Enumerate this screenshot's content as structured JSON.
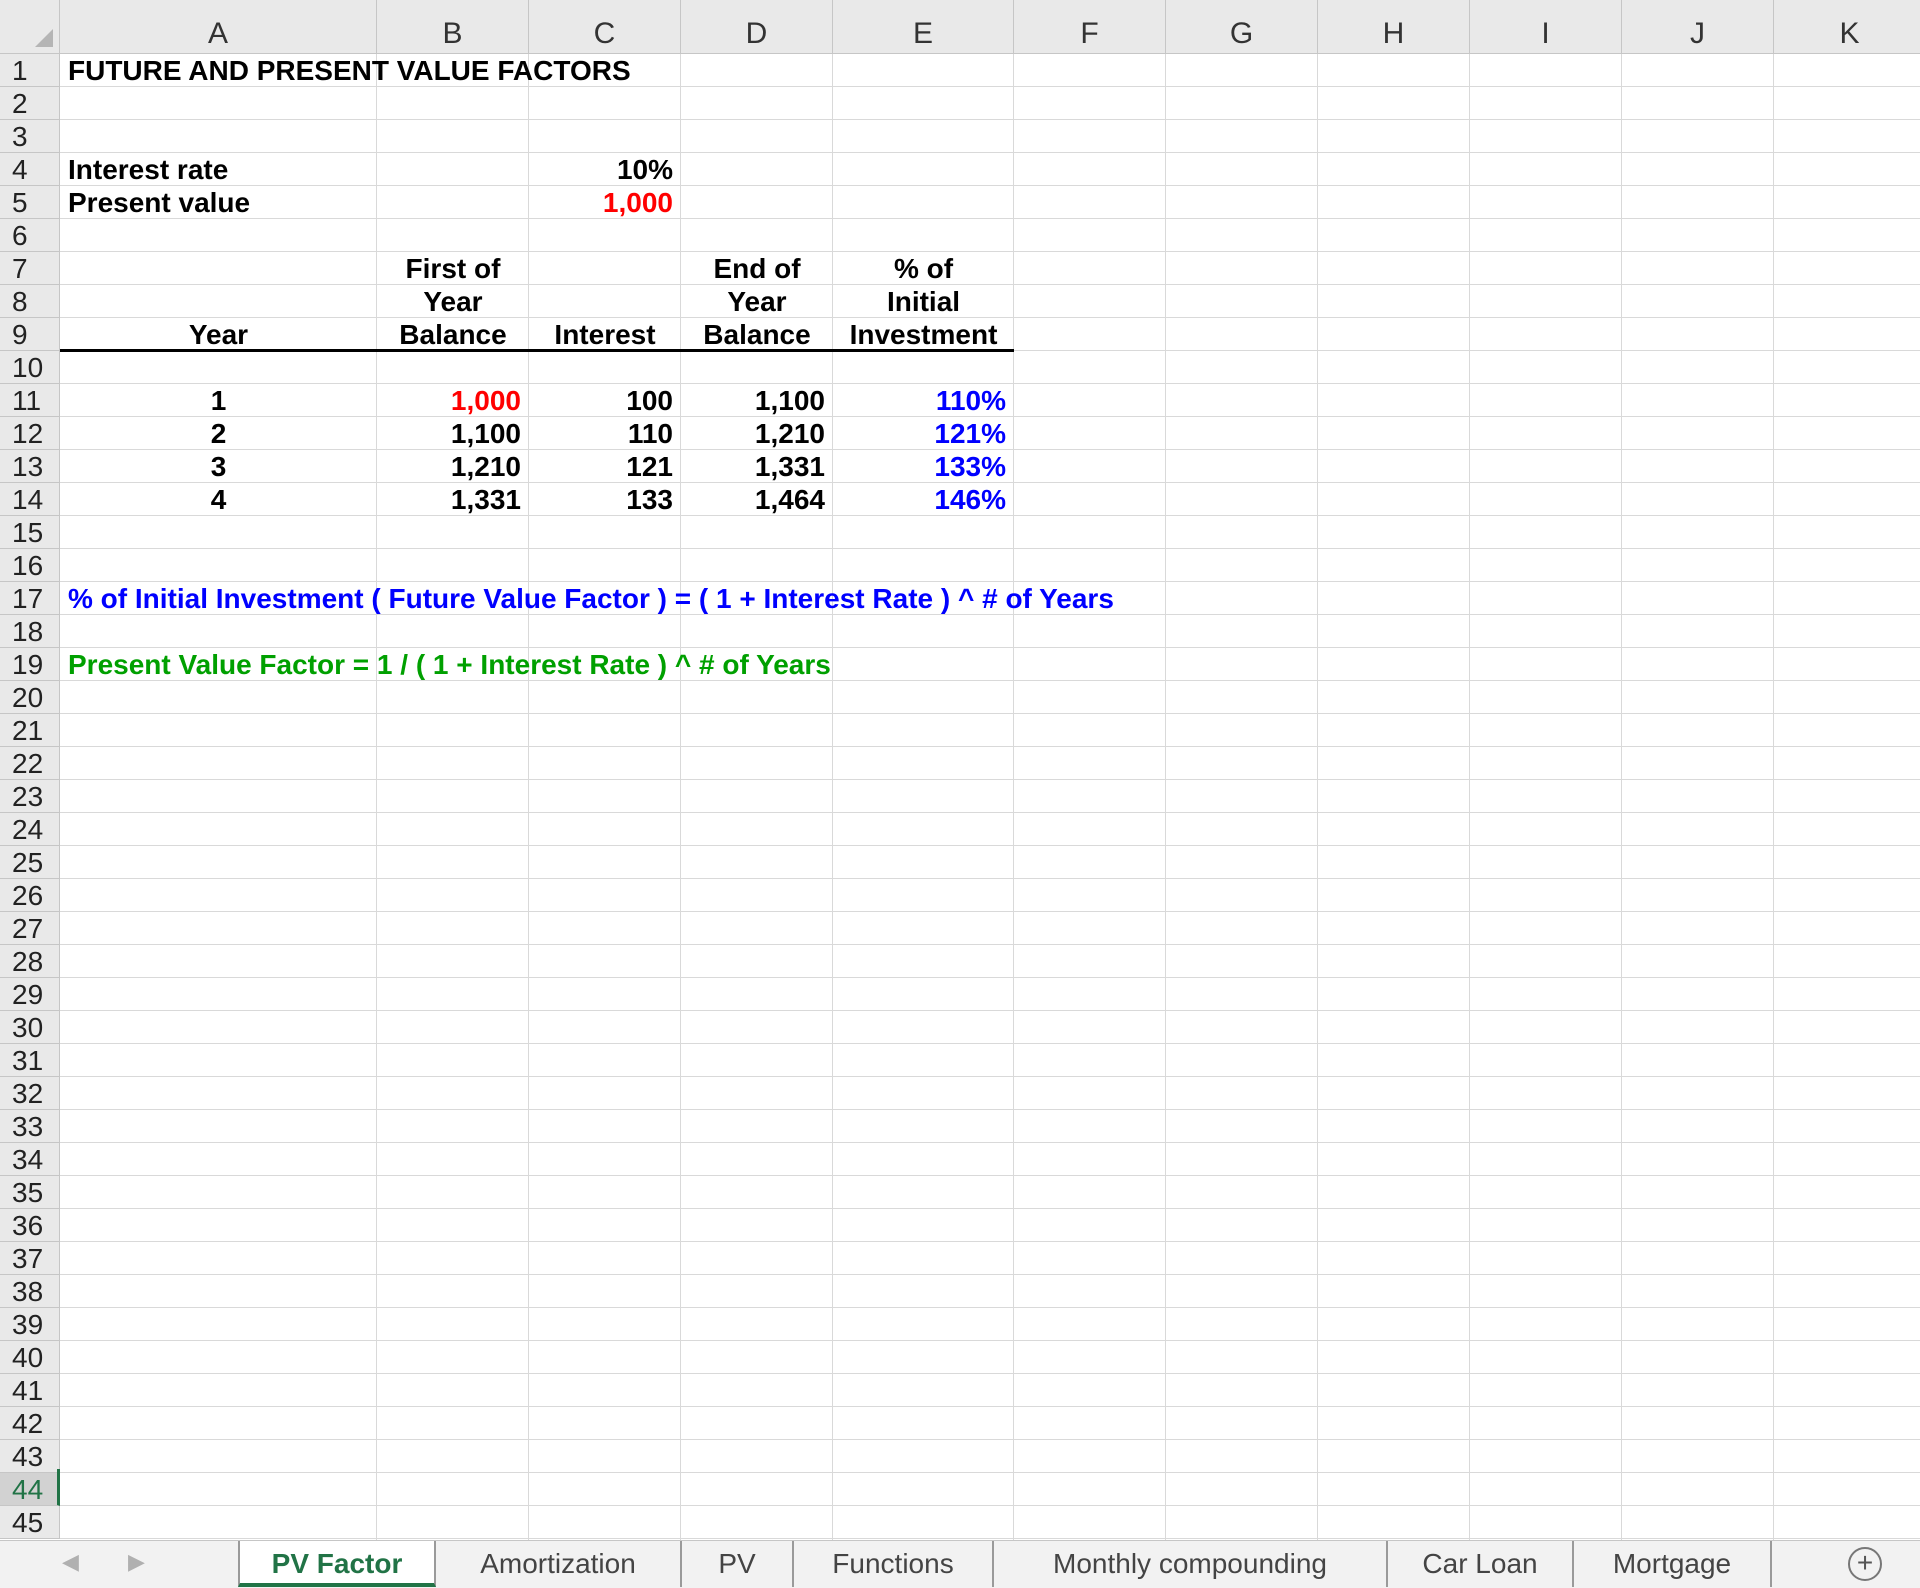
{
  "columns": [
    "A",
    "B",
    "C",
    "D",
    "E",
    "F",
    "G",
    "H",
    "I",
    "J",
    "K"
  ],
  "rows": [
    "1",
    "2",
    "3",
    "4",
    "5",
    "6",
    "7",
    "8",
    "9",
    "10",
    "11",
    "12",
    "13",
    "14",
    "15",
    "16",
    "17",
    "18",
    "19",
    "20",
    "21",
    "22",
    "23",
    "24",
    "25",
    "26",
    "27",
    "28",
    "29",
    "30",
    "31",
    "32",
    "33",
    "34",
    "35",
    "36",
    "37",
    "38",
    "39",
    "40",
    "41",
    "42",
    "43",
    "44",
    "45"
  ],
  "selected_row": "44",
  "sheet": {
    "title": "FUTURE AND PRESENT VALUE FACTORS",
    "interest_rate_label": "Interest rate",
    "interest_rate_value": "10%",
    "present_value_label": "Present value",
    "present_value_value": "1,000",
    "headers": {
      "b_line1": "First of",
      "b_line2": "Year",
      "b_line3": "Balance",
      "c_line3": "Interest",
      "d_line1": "End of",
      "d_line2": "Year",
      "d_line3": "Balance",
      "e_line1": "% of",
      "e_line2": "Initial",
      "e_line3": "Investment",
      "a_line3": "Year"
    },
    "table_rows": [
      {
        "year": "1",
        "first": "1,000",
        "interest": "100",
        "end": "1,100",
        "pct": "110%"
      },
      {
        "year": "2",
        "first": "1,100",
        "interest": "110",
        "end": "1,210",
        "pct": "121%"
      },
      {
        "year": "3",
        "first": "1,210",
        "interest": "121",
        "end": "1,331",
        "pct": "133%"
      },
      {
        "year": "4",
        "first": "1,331",
        "interest": "133",
        "end": "1,464",
        "pct": "146%"
      }
    ],
    "fv_formula_note": "% of Initial Investment ( Future Value Factor )  =  ( 1 + Interest Rate ) ^ # of Years",
    "pv_formula_note": "Present Value Factor  = 1 / ( 1 + Interest Rate ) ^ # of Years"
  },
  "tabs": [
    "PV Factor",
    "Amortization",
    "PV",
    "Functions",
    "Monthly compounding",
    "Car Loan",
    "Mortgage"
  ],
  "active_tab": "PV Factor",
  "icons": {
    "prev": "◀",
    "next": "▶",
    "add": "+"
  },
  "colors": {
    "accent": "#217346",
    "red": "#ff0000",
    "blue": "#0000ff",
    "green": "#00a000"
  }
}
